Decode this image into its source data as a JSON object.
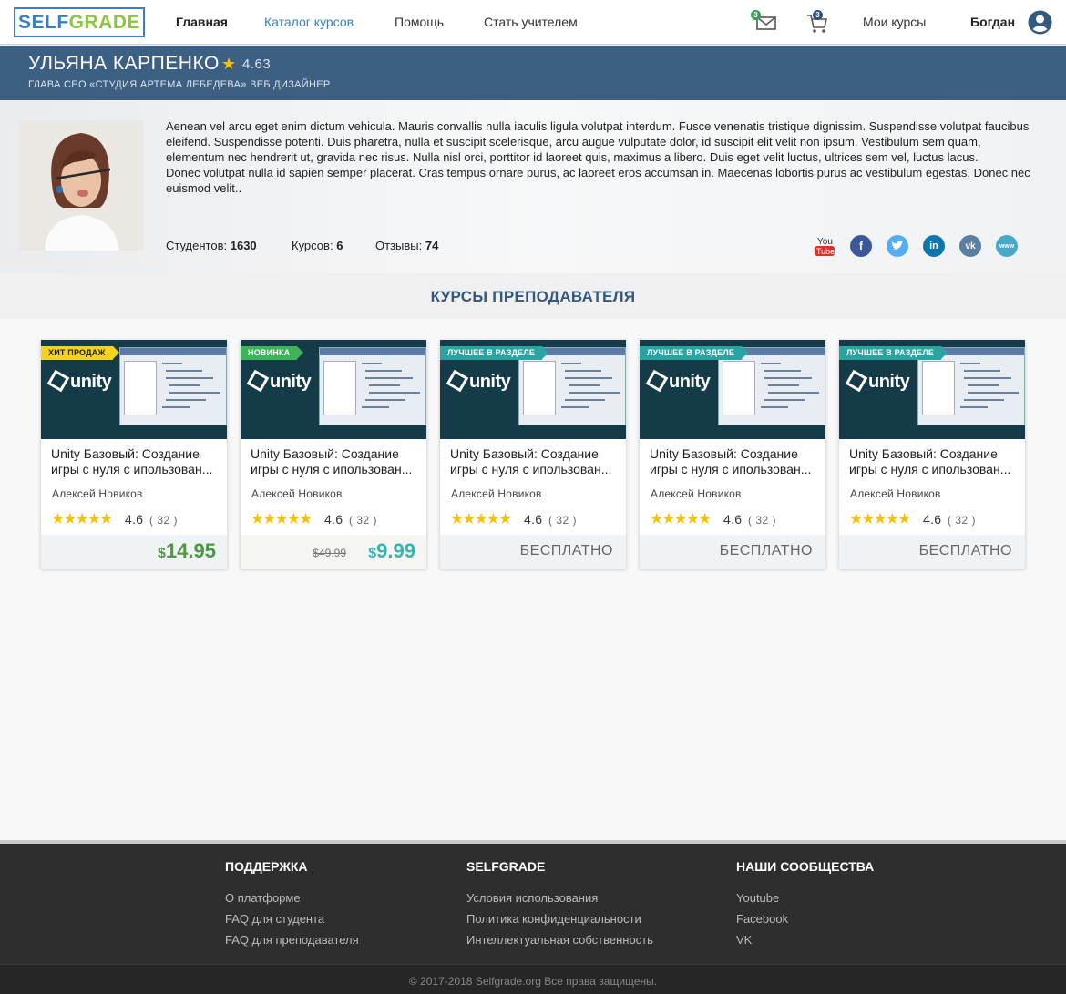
{
  "header": {
    "logo_part1": "SELF",
    "logo_part2": "GRADE",
    "nav": [
      "Главная",
      "Каталог курсов",
      "Помощь",
      "Стать учителем"
    ],
    "messages_badge": "3",
    "cart_badge": "3",
    "my_courses": "Мои курсы",
    "user_name": "Богдан"
  },
  "teacher": {
    "name": "УЛЬЯНА КАРПЕНКО",
    "rating": "4.63",
    "subtitle": "ГЛАВА СЕО «СТУДИЯ АРТЕМА ЛЕБЕДЕВА» ВЕБ ДИЗАЙНЕР",
    "bio_p1": "Aenean vel arcu eget enim dictum vehicula. Mauris convallis nulla iaculis ligula volutpat interdum. Fusce venenatis tristique dignissim. Suspendisse volutpat faucibus eleifend. Suspendisse potenti. Duis pharetra, nulla et suscipit scelerisque, arcu augue vulputate dolor, id suscipit elit velit non ipsum. Vestibulum sem quam, elementum nec hendrerit ut, gravida nec risus. Nulla nisl orci, porttitor id laoreet quis, maximus a libero. Duis eget velit luctus, ultrices sem vel, luctus lacus.",
    "bio_p2": "Donec volutpat nulla id sapien semper placerat. Cras tempus ornare purus, ac laoreet eros accumsan in. Maecenas lobortis purus ac vestibulum egestas. Donec nec euismod velit..",
    "students_label": "Студентов:",
    "students": "1630",
    "courses_label": "Курсов:",
    "courses": "6",
    "reviews_label": "Отзывы:",
    "reviews": "74",
    "social": [
      {
        "icon": "youtube-icon",
        "color": "#e52d27"
      },
      {
        "icon": "facebook-icon",
        "color": "#3b5998"
      },
      {
        "icon": "twitter-icon",
        "color": "#55acee"
      },
      {
        "icon": "linkedin-icon",
        "color": "#0e76a8"
      },
      {
        "icon": "vk-icon",
        "color": "#5b7ea5"
      },
      {
        "icon": "www-icon",
        "color": "#48a8c8"
      }
    ]
  },
  "section_title": "КУРСЫ ПРЕПОДАВАТЕЛЯ",
  "courses": [
    {
      "ribbon": "ХИТ ПРОДАЖ",
      "title": "Unity Базовый: Создание игры с нуля с ипользован...",
      "author": "Алексей Новиков",
      "rating": "4.6",
      "count": "( 32 )",
      "price_currency": "$",
      "price": "14.95",
      "old_price": "",
      "free": ""
    },
    {
      "ribbon": "НОВИНКА",
      "title": "Unity Базовый: Создание игры с нуля с ипользован...",
      "author": "Алексей Новиков",
      "rating": "4.6",
      "count": "( 32 )",
      "price_currency": "$",
      "price": "9.99",
      "old_price": "$49.99",
      "free": ""
    },
    {
      "ribbon": "ЛУЧШЕЕ В РАЗДЕЛЕ",
      "title": "Unity Базовый: Создание игры с нуля с ипользован...",
      "author": "Алексей Новиков",
      "rating": "4.6",
      "count": "( 32 )",
      "price_currency": "",
      "price": "",
      "old_price": "",
      "free": "БЕСПЛАТНО"
    },
    {
      "ribbon": "ЛУЧШЕЕ В РАЗДЕЛЕ",
      "title": "Unity Базовый: Создание игры с нуля с ипользован...",
      "author": "Алексей Новиков",
      "rating": "4.6",
      "count": "( 32 )",
      "price_currency": "",
      "price": "",
      "old_price": "",
      "free": "БЕСПЛАТНО"
    },
    {
      "ribbon": "ЛУЧШЕЕ В РАЗДЕЛЕ",
      "title": "Unity Базовый: Создание игры с нуля с ипользован...",
      "author": "Алексей Новиков",
      "rating": "4.6",
      "count": "( 32 )",
      "price_currency": "",
      "price": "",
      "old_price": "",
      "free": "БЕСПЛАТНО"
    }
  ],
  "thumb_logo": "unity",
  "stars": "★★★★★",
  "footer": {
    "col1_title": "ПОДДЕРЖКА",
    "col1": [
      "О платформе",
      "FAQ для студента",
      "FAQ для преподавателя"
    ],
    "col2_title": "SELFGRADE",
    "col2": [
      "Условия использования",
      "Политика конфиденциальности",
      "Интеллектуальная собственность"
    ],
    "col3_title": "НАШИ СООБЩЕСТВА",
    "col3": [
      "Youtube",
      "Facebook",
      "VK"
    ],
    "copyright": "© 2017-2018 Selfgrade.org Все права защищены."
  }
}
